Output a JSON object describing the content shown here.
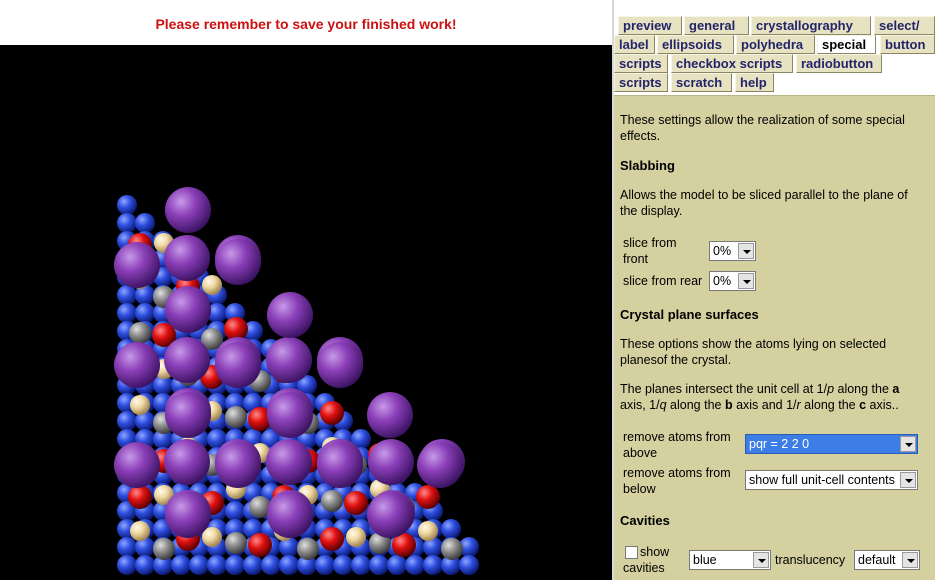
{
  "banner": {
    "message": "Please remember to save your finished work!"
  },
  "tabs": [
    "preview",
    "general",
    "crystallography",
    "select/",
    "label",
    "ellipsoids",
    "polyhedra",
    "special",
    "button",
    "scripts",
    "checkbox scripts",
    "radiobutton",
    "scripts",
    "scratch",
    "help"
  ],
  "active_tab": "special",
  "content": {
    "intro": "These settings allow the realization of some special effects.",
    "slabbing": {
      "heading": "Slabbing",
      "description": "Allows the model to be sliced parallel to the plane of the display.",
      "front_label": "slice from front",
      "front_value": "0%",
      "rear_label": "slice from rear",
      "rear_value": "0%"
    },
    "planes": {
      "heading": "Crystal plane surfaces",
      "description": "These options show the atoms lying on selected planesof the crystal.",
      "note_1": "The planes intersect the unit cell at 1/",
      "note_p": "p",
      "note_2": " along the ",
      "note_a": "a",
      "note_3": " axis, 1/",
      "note_q": "q",
      "note_4": " along the ",
      "note_b": "b",
      "note_5": " axis and 1/",
      "note_r": "r",
      "note_6": " along the ",
      "note_c": "c",
      "note_7": " axis..",
      "above_label": "remove atoms from above",
      "above_value": "pqr = 2 2 0",
      "below_label": "remove atoms from below",
      "below_value": "show full unit-cell contents"
    },
    "cavities": {
      "heading": "Cavities",
      "show_label": "show cavities",
      "color_value": "blue",
      "translucency_label": "translucency",
      "translucency_value": "default"
    }
  },
  "colors": {
    "panel_bg": "#d4d0a0",
    "banner_text": "#cc1111",
    "viewer_bg": "#000000",
    "atom_purple": "#8b3fb8",
    "atom_red": "#e01010",
    "atom_blue": "#2f4fe0",
    "atom_gray": "#8f8f8f",
    "atom_tan": "#efd9a0"
  }
}
